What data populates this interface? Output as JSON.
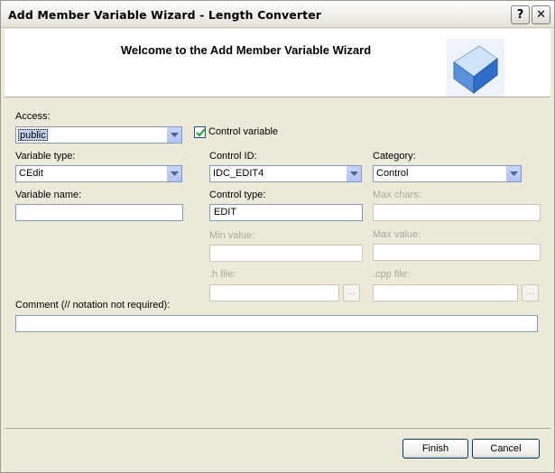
{
  "window": {
    "title": "Add Member Variable Wizard - Length Converter",
    "help_glyph": "?",
    "close_glyph": "✕"
  },
  "header": {
    "title": "Welcome to the Add Member Variable Wizard",
    "icon": "wizard-cube-icon"
  },
  "form": {
    "access": {
      "label": "Access:",
      "value": "public"
    },
    "control_variable": {
      "label": "Control variable",
      "checked": true
    },
    "variable_type": {
      "label": "Variable type:",
      "value": "CEdit"
    },
    "control_id": {
      "label": "Control ID:",
      "value": "IDC_EDIT4"
    },
    "category": {
      "label": "Category:",
      "value": "Control"
    },
    "variable_name": {
      "label": "Variable name:",
      "value": ""
    },
    "control_type": {
      "label": "Control type:",
      "value": "EDIT"
    },
    "max_chars": {
      "label": "Max chars:",
      "value": ""
    },
    "min_value": {
      "label": "Min value:",
      "value": ""
    },
    "max_value": {
      "label": "Max value:",
      "value": ""
    },
    "h_file": {
      "label": ".h file:",
      "value": "",
      "browse": "..."
    },
    "cpp_file": {
      "label": ".cpp file:",
      "value": "",
      "browse": "..."
    },
    "comment": {
      "label": "Comment (// notation not required):",
      "value": ""
    }
  },
  "buttons": {
    "finish": "Finish",
    "cancel": "Cancel"
  }
}
